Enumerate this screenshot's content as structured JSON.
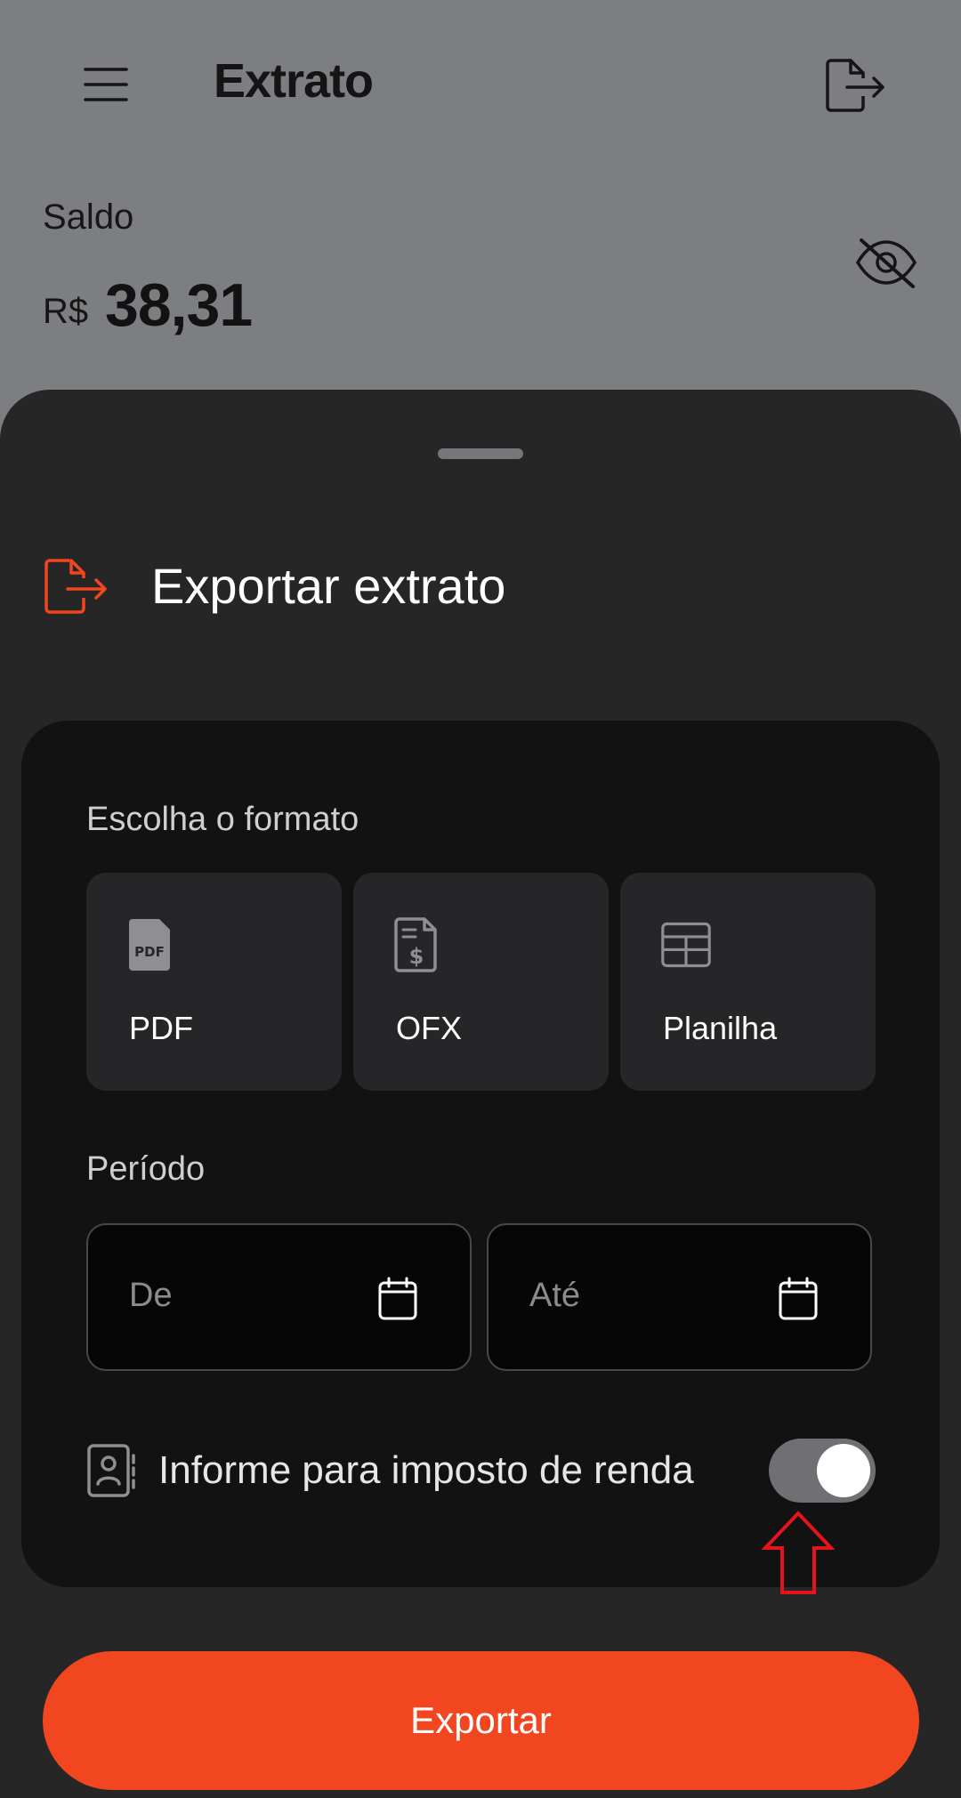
{
  "header": {
    "title": "Extrato"
  },
  "balance": {
    "label": "Saldo",
    "currency": "R$",
    "amount": "38,31"
  },
  "sheet": {
    "title": "Exportar extrato",
    "format_section": "Escolha o formato",
    "formats": [
      {
        "label": "PDF",
        "icon": "pdf-file-icon"
      },
      {
        "label": "OFX",
        "icon": "ofx-file-icon"
      },
      {
        "label": "Planilha",
        "icon": "spreadsheet-icon"
      }
    ],
    "period_section": "Período",
    "date_from_placeholder": "De",
    "date_to_placeholder": "Até",
    "income_tax_label": "Informe para imposto de renda",
    "income_tax_enabled": true,
    "export_button": "Exportar"
  },
  "colors": {
    "accent": "#f1461f",
    "sheet_bg": "#262627",
    "card_bg": "#121213"
  }
}
